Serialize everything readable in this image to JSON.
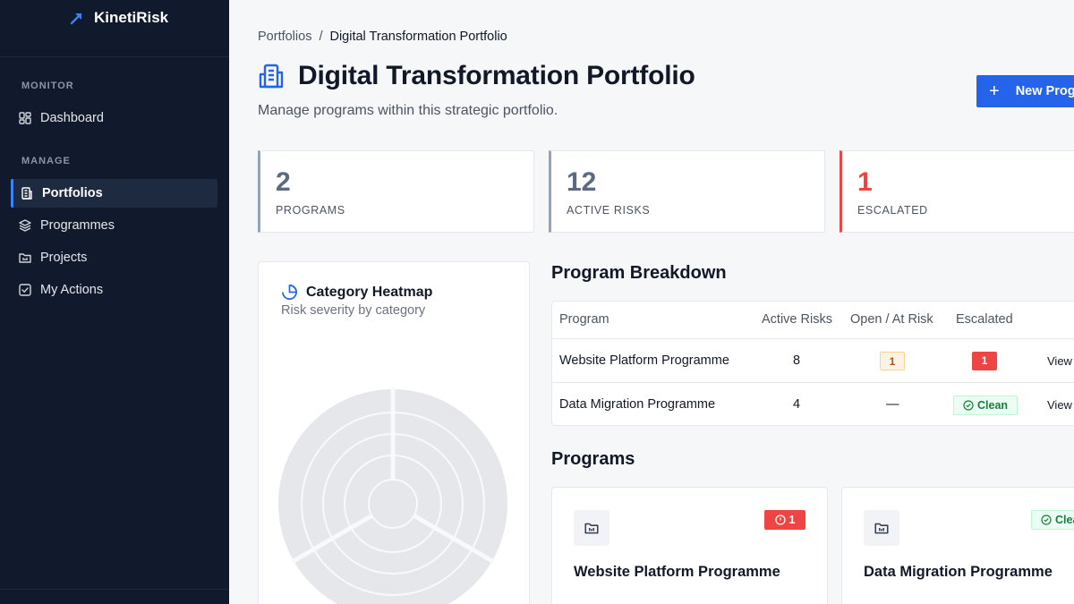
{
  "app": {
    "name": "KinetiRisk"
  },
  "sidebar": {
    "sections": [
      {
        "label": "MONITOR",
        "items": [
          {
            "label": "Dashboard",
            "icon": "dashboard-icon"
          }
        ]
      },
      {
        "label": "MANAGE",
        "items": [
          {
            "label": "Portfolios",
            "icon": "building-icon",
            "active": true
          },
          {
            "label": "Programmes",
            "icon": "layers-icon"
          },
          {
            "label": "Projects",
            "icon": "folder-icon"
          },
          {
            "label": "My Actions",
            "icon": "checkbox-icon"
          }
        ]
      }
    ]
  },
  "breadcrumb": {
    "parent": "Portfolios",
    "separator": "/",
    "current": "Digital Transformation Portfolio"
  },
  "header": {
    "title": "Digital Transformation Portfolio",
    "subtitle": "Manage programs within this strategic portfolio.",
    "new_button_label": "New Program"
  },
  "stats": [
    {
      "value": "2",
      "label": "PROGRAMS"
    },
    {
      "value": "12",
      "label": "ACTIVE RISKS"
    },
    {
      "value": "1",
      "label": "ESCALATED",
      "color": "#ef4444"
    }
  ],
  "heatmap": {
    "title": "Category Heatmap",
    "subtitle": "Risk severity by category"
  },
  "breakdown": {
    "title": "Program Breakdown",
    "columns": [
      "Program",
      "Active Risks",
      "Open / At Risk",
      "Escalated"
    ],
    "rows": [
      {
        "program": "Website Platform Programme",
        "active_risks": "8",
        "open_at_risk": "1",
        "escalated": "1",
        "action": "View"
      },
      {
        "program": "Data Migration Programme",
        "active_risks": "4",
        "open_at_risk": "—",
        "escalated": "Clean",
        "action": "View"
      }
    ]
  },
  "programs": {
    "title": "Programs",
    "cards": [
      {
        "name": "Website Platform Programme",
        "badge": "1",
        "status": "escalated"
      },
      {
        "name": "Data Migration Programme",
        "badge": "Clean",
        "status": "clean"
      }
    ]
  },
  "colors": {
    "sidebar_bg": "#111a2c",
    "accent": "#2563eb",
    "danger": "#ef4444",
    "success": "#15803d",
    "warning": "#b45309"
  }
}
